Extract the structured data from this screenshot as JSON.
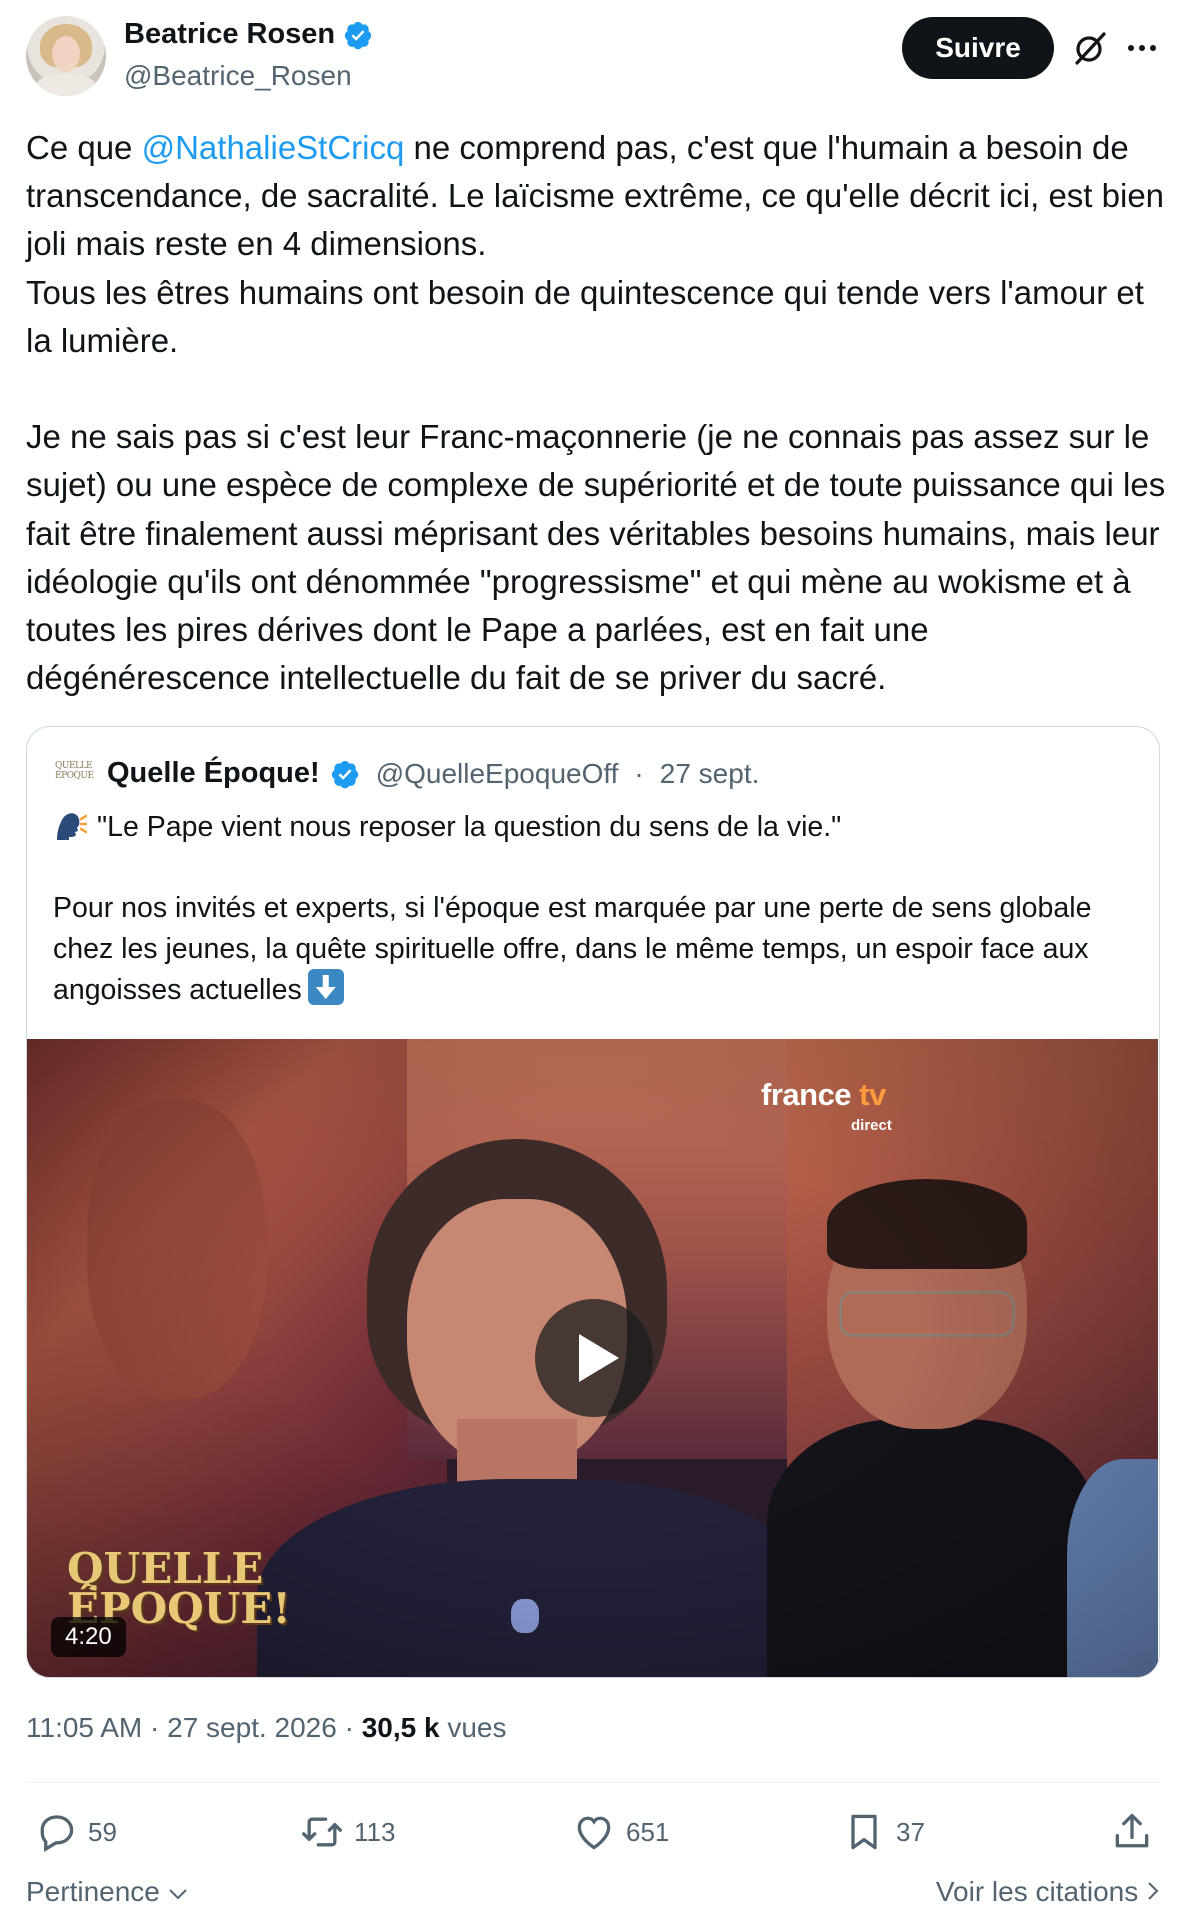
{
  "author": {
    "name": "Beatrice Rosen",
    "handle": "@Beatrice_Rosen",
    "verified": true,
    "avatar_icon": "avatar-photo"
  },
  "header": {
    "follow_label": "Suivre",
    "grok_icon": "grok-icon",
    "more_icon": "more-icon"
  },
  "tweet": {
    "prefix": "Ce que ",
    "mention": "@NathalieStCricq",
    "body": " ne comprend pas, c'est que l'humain a besoin de transcendance, de sacralité. Le laïcisme extrême, ce qu'elle décrit ici, est bien joli mais reste en 4 dimensions.\nTous les êtres humains ont besoin de quintescence qui tende vers l'amour et la lumière.\n\nJe ne sais pas si c'est leur Franc-maçonnerie (je ne connais pas assez sur le sujet) ou une espèce de complexe de supériorité et de toute puissance qui les fait être finalement aussi méprisant des véritables besoins humains, mais leur idéologie qu'ils ont dénommée \"progressisme\" et qui mène au wokisme et à toutes les pires dérives dont le Pape a parlées, est en fait une dégénérescence intellectuelle du fait de se priver du sacré."
  },
  "quoted": {
    "logo_text": "QUELLE ÉPOQUE",
    "name": "Quelle Époque!",
    "verified": true,
    "handle": "@QuelleEpoqueOff",
    "separator": "·",
    "date": "27 sept.",
    "headline": "\"Le Pape vient nous reposer la question du sens de la vie.\"",
    "body": "Pour nos invités et experts, si l'époque est marquée par une perte de sens globale chez les jeunes, la quête spirituelle offre, dans le même temps, un espoir face aux angoisses actuelles",
    "emoji_head": "speaking-head-icon",
    "emoji_arrow": "down-arrow-icon",
    "video": {
      "duration": "4:20",
      "channel_logo_a": "france",
      "channel_logo_b": "tv",
      "channel_sub": "direct",
      "show_logo": "QUELLE ÉPOQUE!",
      "play_icon": "play-icon"
    }
  },
  "meta": {
    "time": "11:05 AM",
    "sep1": "·",
    "date": "27 sept. 2026",
    "sep2": "·",
    "views_count": "30,5 k",
    "views_label": "vues"
  },
  "actions": {
    "replies": "59",
    "retweets": "113",
    "likes": "651",
    "bookmarks": "37"
  },
  "footer": {
    "sort_label": "Pertinence",
    "quotes_label": "Voir les citations"
  },
  "colors": {
    "accent": "#1d9bf0",
    "text": "#0f1419",
    "muted": "#536471",
    "border": "#cfd9de"
  }
}
